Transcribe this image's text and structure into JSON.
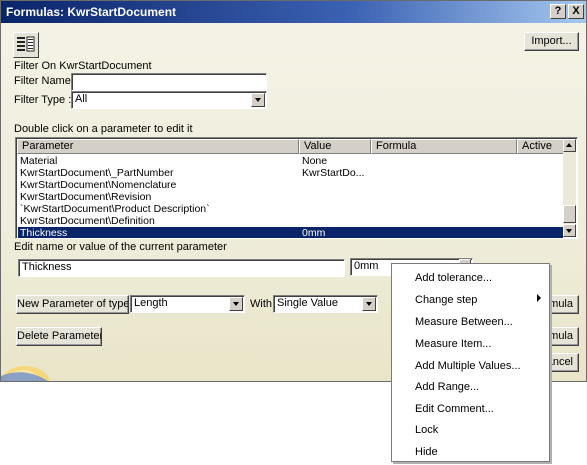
{
  "window": {
    "title": "Formulas: KwrStartDocument",
    "help_glyph": "?",
    "close_glyph": "X"
  },
  "toolbar": {
    "filter_icon": "filter-list-icon",
    "import_label": "Import..."
  },
  "filter": {
    "section_label": "Filter On KwrStartDocument",
    "name_label": "Filter Name :",
    "name_value": "",
    "type_label": "Filter Type :",
    "type_value": "All"
  },
  "table": {
    "caption": "Double click on a parameter to edit it",
    "headers": {
      "parameter": "Parameter",
      "value": "Value",
      "formula": "Formula",
      "active": "Active"
    },
    "rows": [
      {
        "parameter": "Material",
        "value": "None",
        "formula": "",
        "active": ""
      },
      {
        "parameter": "KwrStartDocument\\_PartNumber",
        "value": "KwrStartDo...",
        "formula": "",
        "active": ""
      },
      {
        "parameter": "KwrStartDocument\\Nomenclature",
        "value": "",
        "formula": "",
        "active": ""
      },
      {
        "parameter": "KwrStartDocument\\Revision",
        "value": "",
        "formula": "",
        "active": ""
      },
      {
        "parameter": "`KwrStartDocument\\Product Description`",
        "value": "",
        "formula": "",
        "active": ""
      },
      {
        "parameter": "KwrStartDocument\\Definition",
        "value": "",
        "formula": "",
        "active": ""
      },
      {
        "parameter": "Thickness",
        "value": "0mm",
        "formula": "",
        "active": ""
      }
    ],
    "selected_row_index": 6
  },
  "edit": {
    "caption": "Edit name or value of the current parameter",
    "name_value": "Thickness",
    "value_value": "0mm"
  },
  "new_param": {
    "button_label": "New Parameter of type",
    "type_value": "Length",
    "with_label": "With",
    "with_value": "Single Value"
  },
  "buttons": {
    "delete_label": "Delete Parameter",
    "formula_partial_1": "mula",
    "formula_partial_2": "mula",
    "cancel_partial": "ancel"
  },
  "context_menu": {
    "items": [
      {
        "label": "Add tolerance...",
        "submenu": false
      },
      {
        "label": "Change step",
        "submenu": true
      },
      {
        "label": "Measure Between...",
        "submenu": false
      },
      {
        "label": "Measure Item...",
        "submenu": false
      },
      {
        "label": "Add Multiple Values...",
        "submenu": false
      },
      {
        "label": "Add Range...",
        "submenu": false
      },
      {
        "label": "Edit Comment...",
        "submenu": false
      },
      {
        "label": "Lock",
        "submenu": false
      },
      {
        "label": "Hide",
        "submenu": false
      }
    ]
  },
  "colors": {
    "title_bar": "#0a246a",
    "selection": "#0a246a",
    "dialog_bg": "#f1efde"
  }
}
